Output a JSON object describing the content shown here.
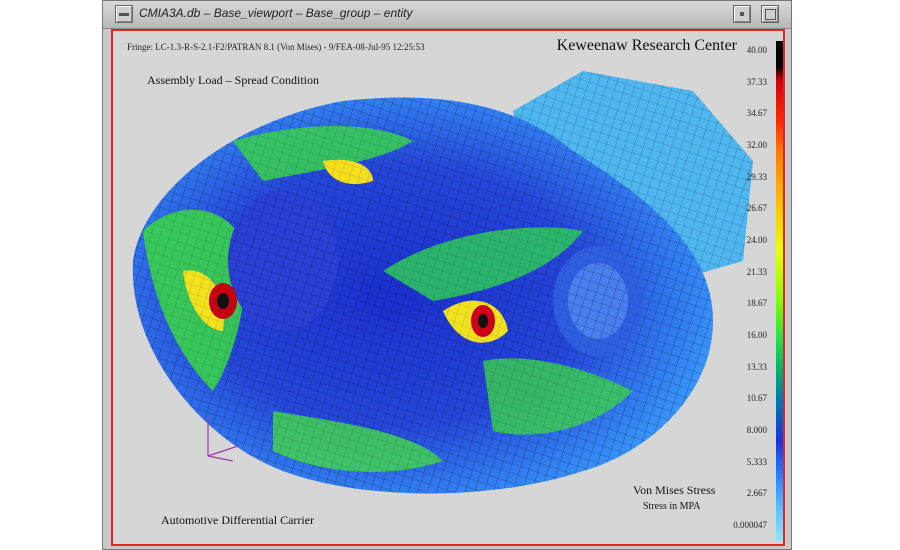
{
  "window": {
    "title": "CMIA3A.db – Base_viewport – Base_group – entity"
  },
  "header": {
    "fringe_line": "Fringe: LC-1.3-R-S-2.1-F2/PATRAN 8.1 (Von Mises) - 9/FEA-08-Jul-95 12:25:53",
    "organization": "Keweenaw Research Center",
    "load_case": "Assembly Load – Spread Condition"
  },
  "caption": {
    "title": "Automotive Differential Carrier"
  },
  "legend": {
    "title": "Von Mises Stress",
    "subtitle": "Stress in MPA",
    "ticks": [
      "40.00",
      "37.33",
      "34.67",
      "32.00",
      "29.33",
      "26.67",
      "24.00",
      "21.33",
      "18.67",
      "16.00",
      "13.33",
      "10.67",
      "8.000",
      "5.333",
      "2.667",
      "0.000047"
    ]
  },
  "colors": {
    "frame": "#e0242b",
    "background": "#d6d6d6"
  }
}
